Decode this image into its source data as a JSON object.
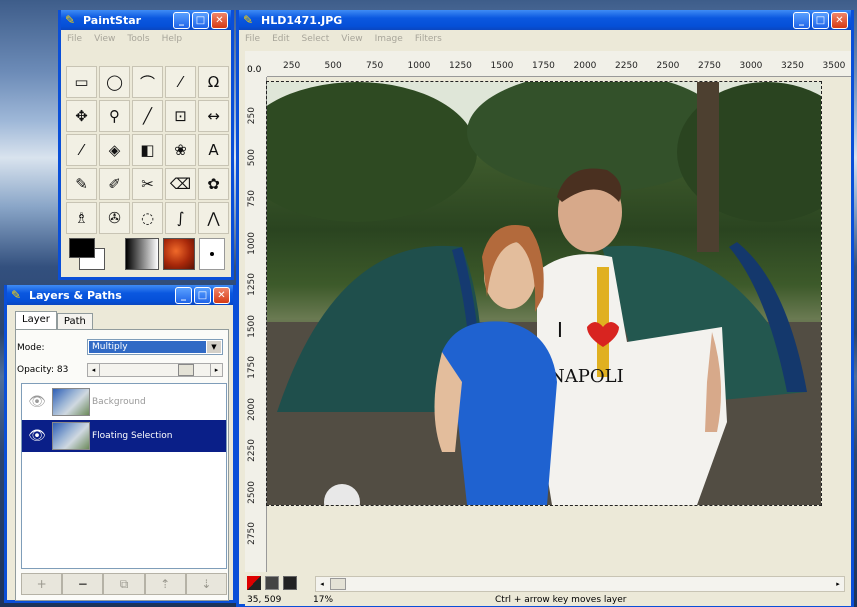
{
  "toolbox": {
    "title": "PaintStar",
    "menu": [
      "File",
      "View",
      "Tools",
      "Help"
    ],
    "tools": [
      "rect-select",
      "ellipse-select",
      "lasso",
      "magic-wand",
      "path",
      "move",
      "zoom",
      "line",
      "crop",
      "flip",
      "eyedropper",
      "fill",
      "gradient",
      "clone",
      "text",
      "pencil",
      "brush",
      "airbrush",
      "eraser",
      "stamp",
      "smudge",
      "dodge",
      "blur",
      "smear",
      "measure"
    ],
    "tool_glyphs": [
      "▭",
      "◯",
      "⌒",
      "⁄",
      "Ω",
      "✥",
      "⚲",
      "╱",
      "⊡",
      "↔",
      "⁄",
      "◈",
      "◧",
      "❀",
      "A",
      "✎",
      "✐",
      "✂",
      "⌫",
      "✿",
      "♗",
      "✇",
      "◌",
      "∫",
      "⋀"
    ],
    "fg_color": "#000000",
    "bg_color": "#ffffff"
  },
  "layers_panel": {
    "title": "Layers & Paths",
    "tabs": [
      "Layer",
      "Path"
    ],
    "mode_label": "Mode:",
    "mode_value": "Multiply",
    "opacity_label": "Opacity: 83",
    "layers": [
      {
        "name": "Background",
        "visible": true,
        "selected": false
      },
      {
        "name": "Floating Selection",
        "visible": true,
        "selected": true
      }
    ],
    "buttons": [
      "+",
      "−",
      "⧉",
      "⇡",
      "⇣"
    ]
  },
  "image_window": {
    "title": "HLD1471.JPG",
    "menu": [
      "File",
      "Edit",
      "Select",
      "View",
      "Image",
      "Filters"
    ],
    "ruler_origin": "0.0",
    "h_ticks": [
      "250",
      "500",
      "750",
      "1000",
      "1250",
      "1500",
      "1750",
      "2000",
      "2250",
      "2500",
      "2750",
      "3000",
      "3250",
      "3500"
    ],
    "v_ticks": [
      "250",
      "500",
      "750",
      "1000",
      "1250",
      "1500",
      "1750",
      "2000",
      "2250",
      "2500",
      "2750"
    ],
    "status_coords": "35, 509",
    "zoom": "17%",
    "status_hint": "Ctrl + arrow key moves layer"
  }
}
